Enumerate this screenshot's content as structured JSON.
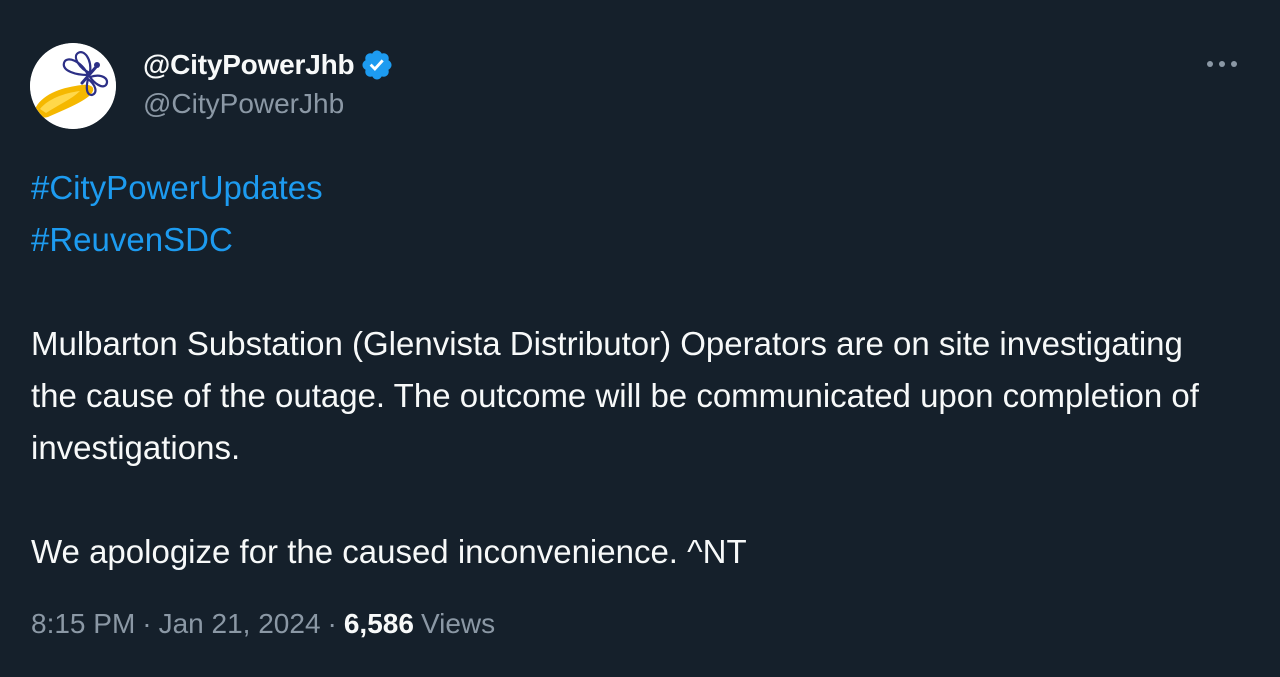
{
  "author": {
    "display_name": "@CityPowerJhb",
    "handle": "@CityPowerJhb",
    "verified": true,
    "avatar_icon": "dragonfly-logo-icon"
  },
  "tweet": {
    "hashtags": [
      "#CityPowerUpdates",
      "#ReuvenSDC"
    ],
    "paragraph_1": "Mulbarton Substation (Glenvista Distributor) Operators are on site investigating the cause of the outage. The outcome will be communicated upon completion of investigations.",
    "paragraph_2": "We apologize for the caused inconvenience. ^NT"
  },
  "meta": {
    "time": "8:15 PM",
    "separator": "·",
    "date": "Jan 21, 2024",
    "views_count": "6,586",
    "views_label": "Views"
  },
  "colors": {
    "background": "#15202b",
    "text": "#f7f9f9",
    "secondary": "#8b98a5",
    "link": "#1d9bf0",
    "verified": "#1d9bf0"
  }
}
